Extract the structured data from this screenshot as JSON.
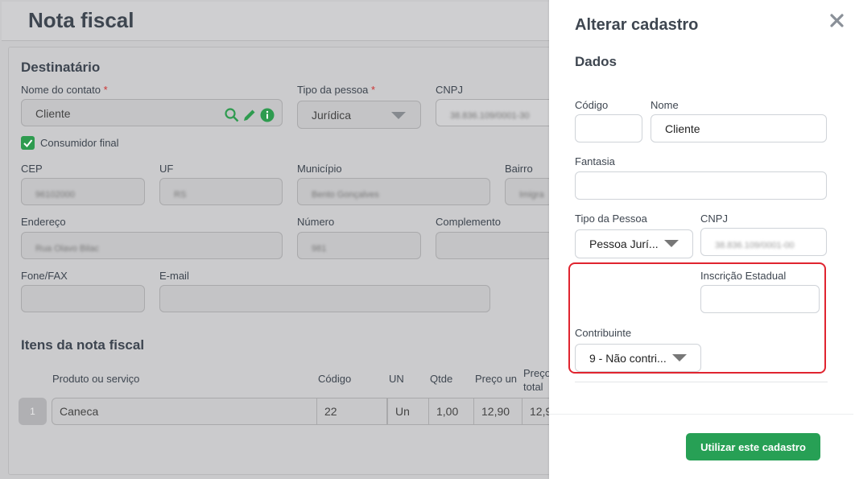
{
  "page": {
    "title": "Nota fiscal",
    "destinatario": {
      "title": "Destinatário",
      "nome_label": "Nome do contato",
      "nome_value": "Cliente",
      "tipo_label": "Tipo da pessoa",
      "tipo_value": "Jurídica",
      "cnpj_label": "CNPJ",
      "cnpj_value": "38.836.109/0001-30",
      "consumidor_final_label": "Consumidor final",
      "cep_label": "CEP",
      "cep_value": "96102000",
      "uf_label": "UF",
      "uf_value": "RS",
      "municipio_label": "Município",
      "municipio_value": "Bento Gonçalves",
      "bairro_label": "Bairro",
      "bairro_value": "Imigra",
      "endereco_label": "Endereço",
      "endereco_value": "Rua Olavo Bilac",
      "numero_label": "Número",
      "numero_value": "981",
      "complemento_label": "Complemento",
      "fone_label": "Fone/FAX",
      "email_label": "E-mail"
    },
    "itens": {
      "title": "Itens da nota fiscal",
      "headers": [
        "Produto ou serviço",
        "Código",
        "UN",
        "Qtde",
        "Preço un",
        "Preço total"
      ],
      "rows": [
        {
          "num": "1",
          "produto": "Caneca",
          "codigo": "22",
          "un": "Un",
          "qtde": "1,00",
          "preco_un": "12,90",
          "preco_total": "12,9"
        }
      ]
    }
  },
  "modal": {
    "title": "Alterar cadastro",
    "section": "Dados",
    "codigo_label": "Código",
    "codigo_value": "",
    "nome_label": "Nome",
    "nome_value": "Cliente",
    "fantasia_label": "Fantasia",
    "fantasia_value": "",
    "tipo_label": "Tipo da Pessoa",
    "tipo_value": "Pessoa Jurí...",
    "cnpj_label": "CNPJ",
    "cnpj_value": "38.836.109/0001-00",
    "ie_label": "Inscrição Estadual",
    "ie_value": "",
    "contribuinte_label": "Contribuinte",
    "contribuinte_value": "9 - Não contri...",
    "submit_label": "Utilizar este cadastro",
    "close_icon": "close-icon"
  },
  "colors": {
    "accent_green": "#27a055",
    "highlight_red": "#e0242f",
    "icon_green": "#2e9b4f"
  }
}
